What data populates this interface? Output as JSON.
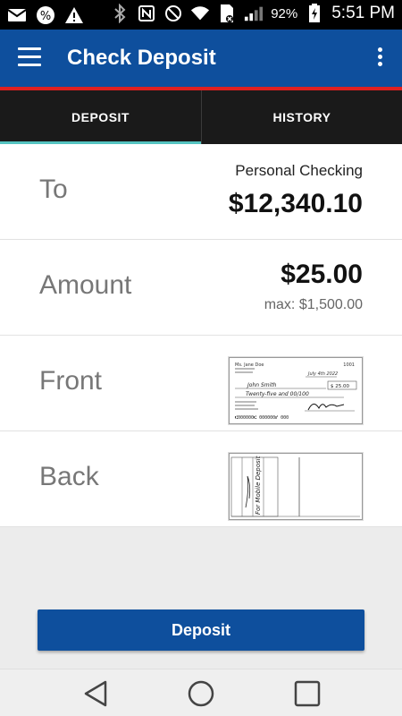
{
  "status_bar": {
    "battery_percent": "92%",
    "time": "5:51 PM"
  },
  "app_bar": {
    "title": "Check Deposit"
  },
  "tabs": [
    {
      "label": "DEPOSIT",
      "selected": true
    },
    {
      "label": "HISTORY",
      "selected": false
    }
  ],
  "form": {
    "to": {
      "label": "To",
      "account_name": "Personal Checking",
      "balance": "$12,340.10"
    },
    "amount": {
      "label": "Amount",
      "value": "$25.00",
      "max": "max: $1,500.00"
    },
    "front": {
      "label": "Front"
    },
    "back": {
      "label": "Back"
    }
  },
  "check_front": {
    "name": "Ms. Jane Doe",
    "check_number": "1001",
    "date": "July 4th 2022",
    "payee": "John Smith",
    "amount_box": "$ 25.00",
    "amount_words": "Twenty-five and 00/100"
  },
  "check_back": {
    "endorsement": "For Mobile Deposit"
  },
  "actions": {
    "deposit_label": "Deposit"
  },
  "colors": {
    "primary": "#0e4f9d",
    "accent_red": "#e02020",
    "tab_indicator": "#55c3c0",
    "tab_bar": "#1a1a1a"
  }
}
